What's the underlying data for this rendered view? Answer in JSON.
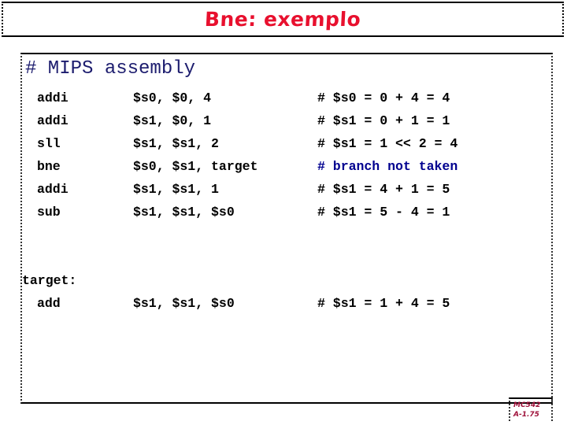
{
  "slide": {
    "title": "Bne: exemplo",
    "title_color": "#e8102e",
    "background": "#ffffff"
  },
  "code": {
    "heading": "# MIPS assembly",
    "heading_color": "#1c1c6e",
    "highlight_color": "#00008f",
    "text_color": "#000000",
    "lines": [
      {
        "mnemonic": "addi",
        "operands": "$s0, $0, 4",
        "comment": "# $s0 = 0 + 4 = 4",
        "is_label": false,
        "highlight": false
      },
      {
        "mnemonic": "addi",
        "operands": "$s1, $0, 1",
        "comment": "# $s1 = 0 + 1 = 1",
        "is_label": false,
        "highlight": false
      },
      {
        "mnemonic": "sll",
        "operands": "$s1, $s1, 2",
        "comment": "# $s1 = 1 << 2 = 4",
        "is_label": false,
        "highlight": false
      },
      {
        "mnemonic": "bne",
        "operands": "$s0, $s1, target",
        "comment": "# branch not taken",
        "is_label": false,
        "highlight": true
      },
      {
        "mnemonic": "addi",
        "operands": "$s1, $s1, 1",
        "comment": "# $s1 = 4 + 1 = 5",
        "is_label": false,
        "highlight": false
      },
      {
        "mnemonic": "sub",
        "operands": "$s1, $s1, $s0",
        "comment": "# $s1 = 5 - 4 = 1",
        "is_label": false,
        "highlight": false
      },
      {
        "mnemonic": "",
        "operands": "",
        "comment": "",
        "is_label": false,
        "highlight": false
      },
      {
        "mnemonic": "",
        "operands": "",
        "comment": "",
        "is_label": false,
        "highlight": false
      },
      {
        "mnemonic": "target:",
        "operands": "",
        "comment": "",
        "is_label": true,
        "highlight": false
      },
      {
        "mnemonic": "add",
        "operands": "$s1, $s1, $s0",
        "comment": "# $s1 = 1 + 4 = 5",
        "is_label": false,
        "highlight": false
      }
    ]
  },
  "footer": {
    "course": "MC542",
    "page": "A-1.75",
    "color": "#9e1039"
  }
}
